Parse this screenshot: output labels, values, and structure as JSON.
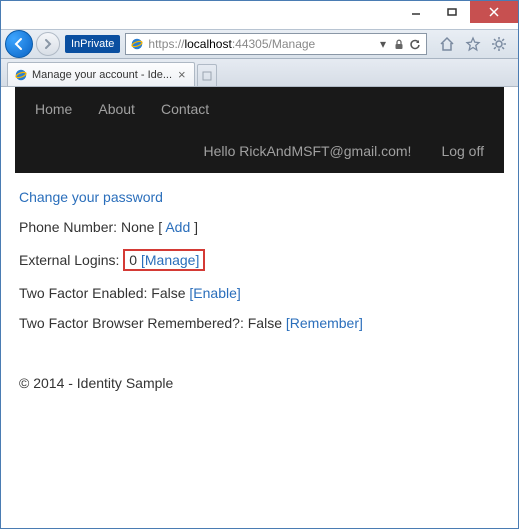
{
  "window": {
    "titlebar_visible": false
  },
  "ie": {
    "inprivate_label": "InPrivate",
    "url_scheme": "https://",
    "url_host": "localhost",
    "url_port_path": ":44305/Manage",
    "tab_title": "Manage your account - Ide...",
    "refresh_icon": "refresh-icon",
    "stop_icon": "lock-icon"
  },
  "nav": {
    "home": "Home",
    "about": "About",
    "contact": "Contact",
    "hello": "Hello RickAndMSFT@gmail.com!",
    "logoff": "Log off"
  },
  "content": {
    "change_pw": "Change your password",
    "phone_label": "Phone Number:",
    "phone_value": "None",
    "phone_add": "Add",
    "ext_label": "External Logins:",
    "ext_count": "0",
    "ext_manage": "[Manage]",
    "tfa_label": "Two Factor Enabled:",
    "tfa_value": "False",
    "tfa_enable": "[Enable]",
    "browser_label": "Two Factor Browser Remembered?:",
    "browser_value": "False",
    "browser_remember": "[Remember]",
    "footer": "© 2014 - Identity Sample"
  }
}
